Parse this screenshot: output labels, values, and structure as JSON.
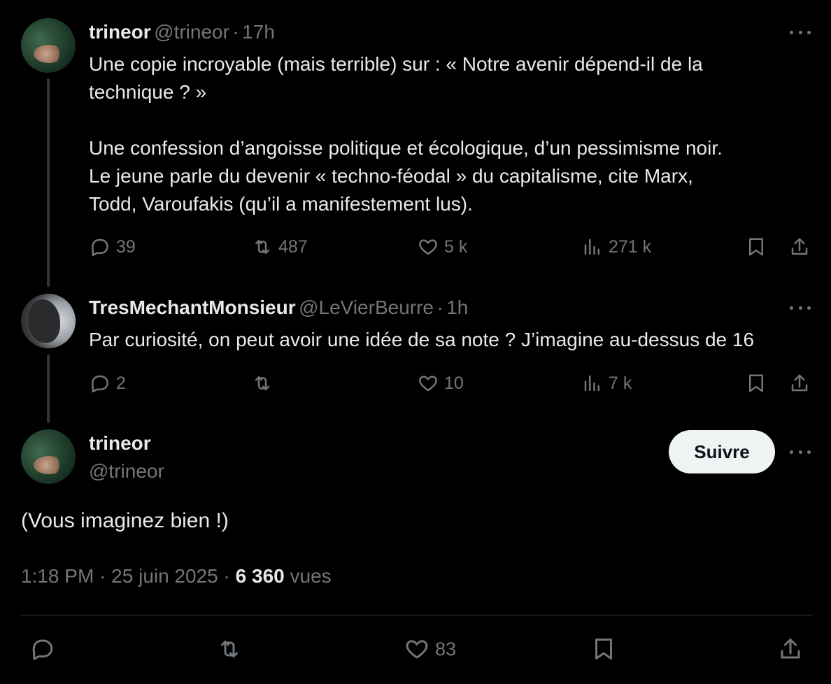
{
  "tweet1": {
    "name": "trineor",
    "handle": "@trineor",
    "sep": "·",
    "time": "17h",
    "lines": [
      "Une copie incroyable (mais terrible) sur : « Notre avenir dépend-il de la",
      "technique ? »",
      "",
      "Une confession d’angoisse politique et écologique, d’un pessimisme noir.",
      "Le jeune parle du devenir « techno-féodal » du capitalisme, cite Marx,",
      "Todd, Varoufakis (qu’il a manifestement lus)."
    ],
    "replies": "39",
    "reposts": "487",
    "likes": "5 k",
    "views": "271 k"
  },
  "tweet2": {
    "name": "TresMechantMonsieur",
    "handle": "@LeVierBeurre",
    "sep": "·",
    "time": "1h",
    "text": "Par curiosité, on peut avoir une idée de sa note ? J’imagine au-dessus de 16",
    "replies": "2",
    "reposts": "",
    "likes": "10",
    "views": "7 k"
  },
  "main": {
    "name": "trineor",
    "handle": "@trineor",
    "follow_label": "Suivre",
    "text": "(Vous imaginez bien !)",
    "time": "1:18 PM",
    "sep1": "·",
    "date": "25 juin 2025",
    "sep2": "·",
    "views_count": "6 360",
    "views_label": "vues",
    "likes": "83"
  },
  "icons": {
    "reply": "reply-icon",
    "repost": "repost-icon",
    "like": "heart-icon",
    "views": "views-icon",
    "bookmark": "bookmark-icon",
    "share": "share-icon",
    "more": "more-icon"
  }
}
